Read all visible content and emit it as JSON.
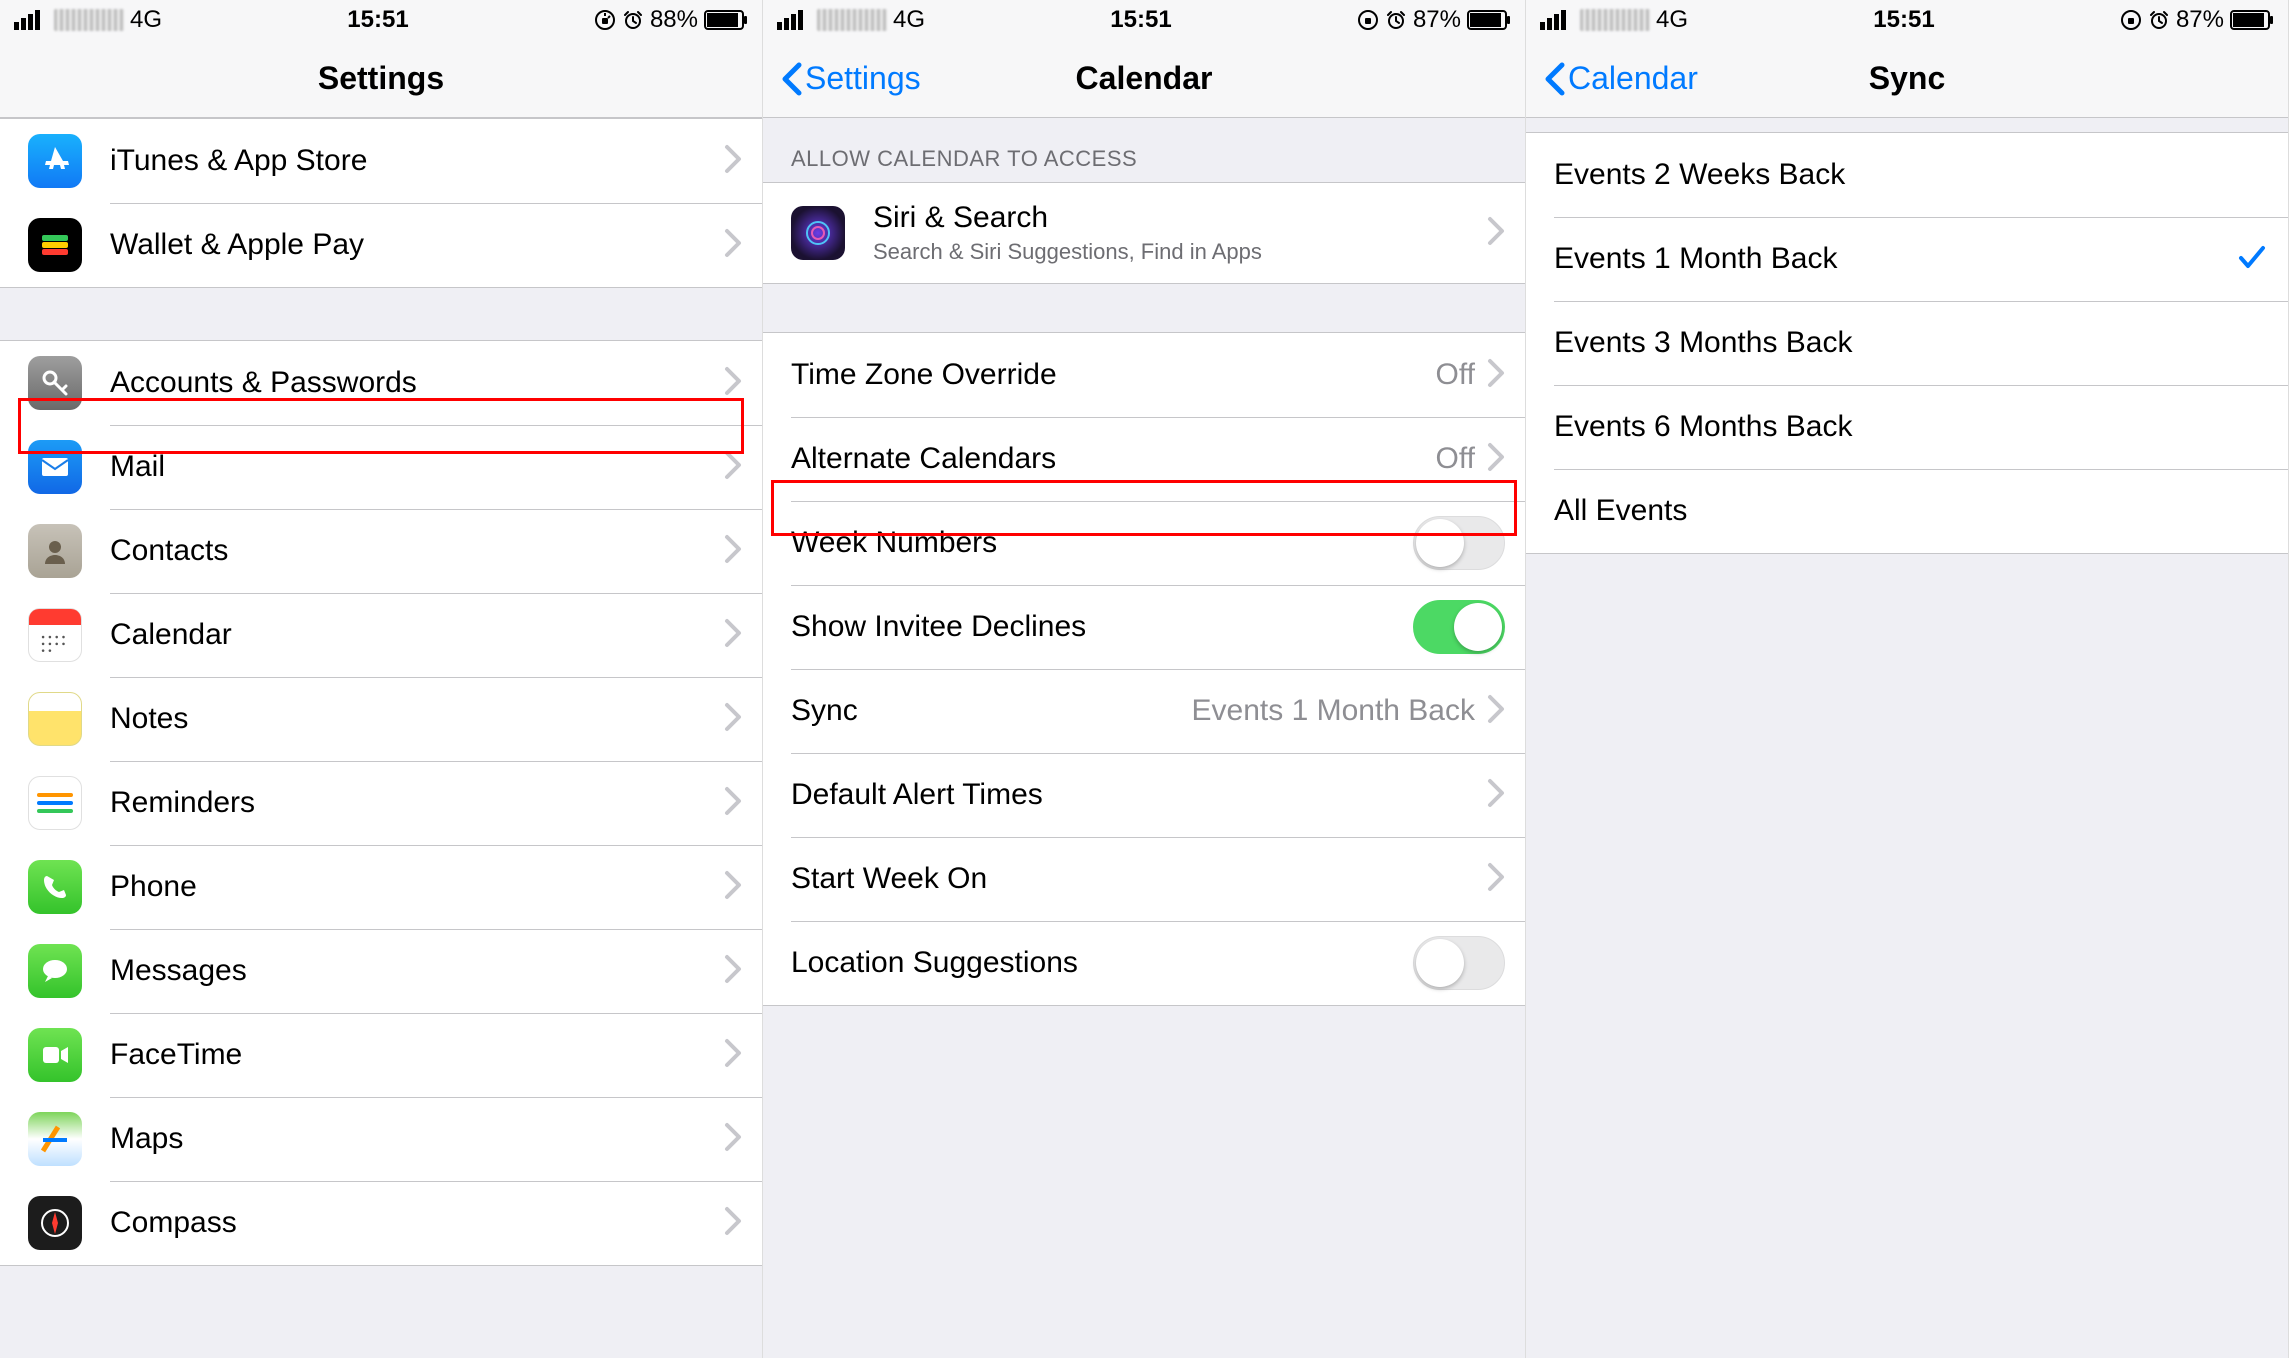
{
  "panes": {
    "settings": {
      "status": {
        "network": "4G",
        "time": "15:51",
        "battery": "88%"
      },
      "title": "Settings",
      "groups": [
        {
          "items": [
            {
              "id": "itunes",
              "label": "iTunes & App Store"
            },
            {
              "id": "wallet",
              "label": "Wallet & Apple Pay"
            }
          ]
        },
        {
          "items": [
            {
              "id": "accounts",
              "label": "Accounts & Passwords"
            },
            {
              "id": "mail",
              "label": "Mail"
            },
            {
              "id": "contacts",
              "label": "Contacts"
            },
            {
              "id": "calendar",
              "label": "Calendar",
              "highlighted": true
            },
            {
              "id": "notes",
              "label": "Notes"
            },
            {
              "id": "reminders",
              "label": "Reminders"
            },
            {
              "id": "phone",
              "label": "Phone"
            },
            {
              "id": "messages",
              "label": "Messages"
            },
            {
              "id": "facetime",
              "label": "FaceTime"
            },
            {
              "id": "maps",
              "label": "Maps"
            },
            {
              "id": "compass",
              "label": "Compass"
            }
          ]
        }
      ]
    },
    "calendar": {
      "status": {
        "network": "4G",
        "time": "15:51",
        "battery": "87%"
      },
      "back": "Settings",
      "title": "Calendar",
      "section_header": "ALLOW CALENDAR TO ACCESS",
      "siri": {
        "label": "Siri & Search",
        "sub": "Search & Siri Suggestions, Find in Apps"
      },
      "rows": [
        {
          "id": "tz",
          "label": "Time Zone Override",
          "value": "Off",
          "kind": "nav"
        },
        {
          "id": "alt",
          "label": "Alternate Calendars",
          "value": "Off",
          "kind": "nav"
        },
        {
          "id": "weeknum",
          "label": "Week Numbers",
          "kind": "toggle",
          "on": false
        },
        {
          "id": "invitee",
          "label": "Show Invitee Declines",
          "kind": "toggle",
          "on": true
        },
        {
          "id": "sync",
          "label": "Sync",
          "value": "Events 1 Month Back",
          "kind": "nav",
          "highlighted": true
        },
        {
          "id": "alerts",
          "label": "Default Alert Times",
          "kind": "nav"
        },
        {
          "id": "startweek",
          "label": "Start Week On",
          "kind": "nav"
        },
        {
          "id": "location",
          "label": "Location Suggestions",
          "kind": "toggle",
          "on": false
        }
      ]
    },
    "sync": {
      "status": {
        "network": "4G",
        "time": "15:51",
        "battery": "87%"
      },
      "back": "Calendar",
      "title": "Sync",
      "options": [
        {
          "label": "Events 2 Weeks Back",
          "selected": false
        },
        {
          "label": "Events 1 Month Back",
          "selected": true
        },
        {
          "label": "Events 3 Months Back",
          "selected": false
        },
        {
          "label": "Events 6 Months Back",
          "selected": false
        },
        {
          "label": "All Events",
          "selected": false
        }
      ]
    }
  }
}
